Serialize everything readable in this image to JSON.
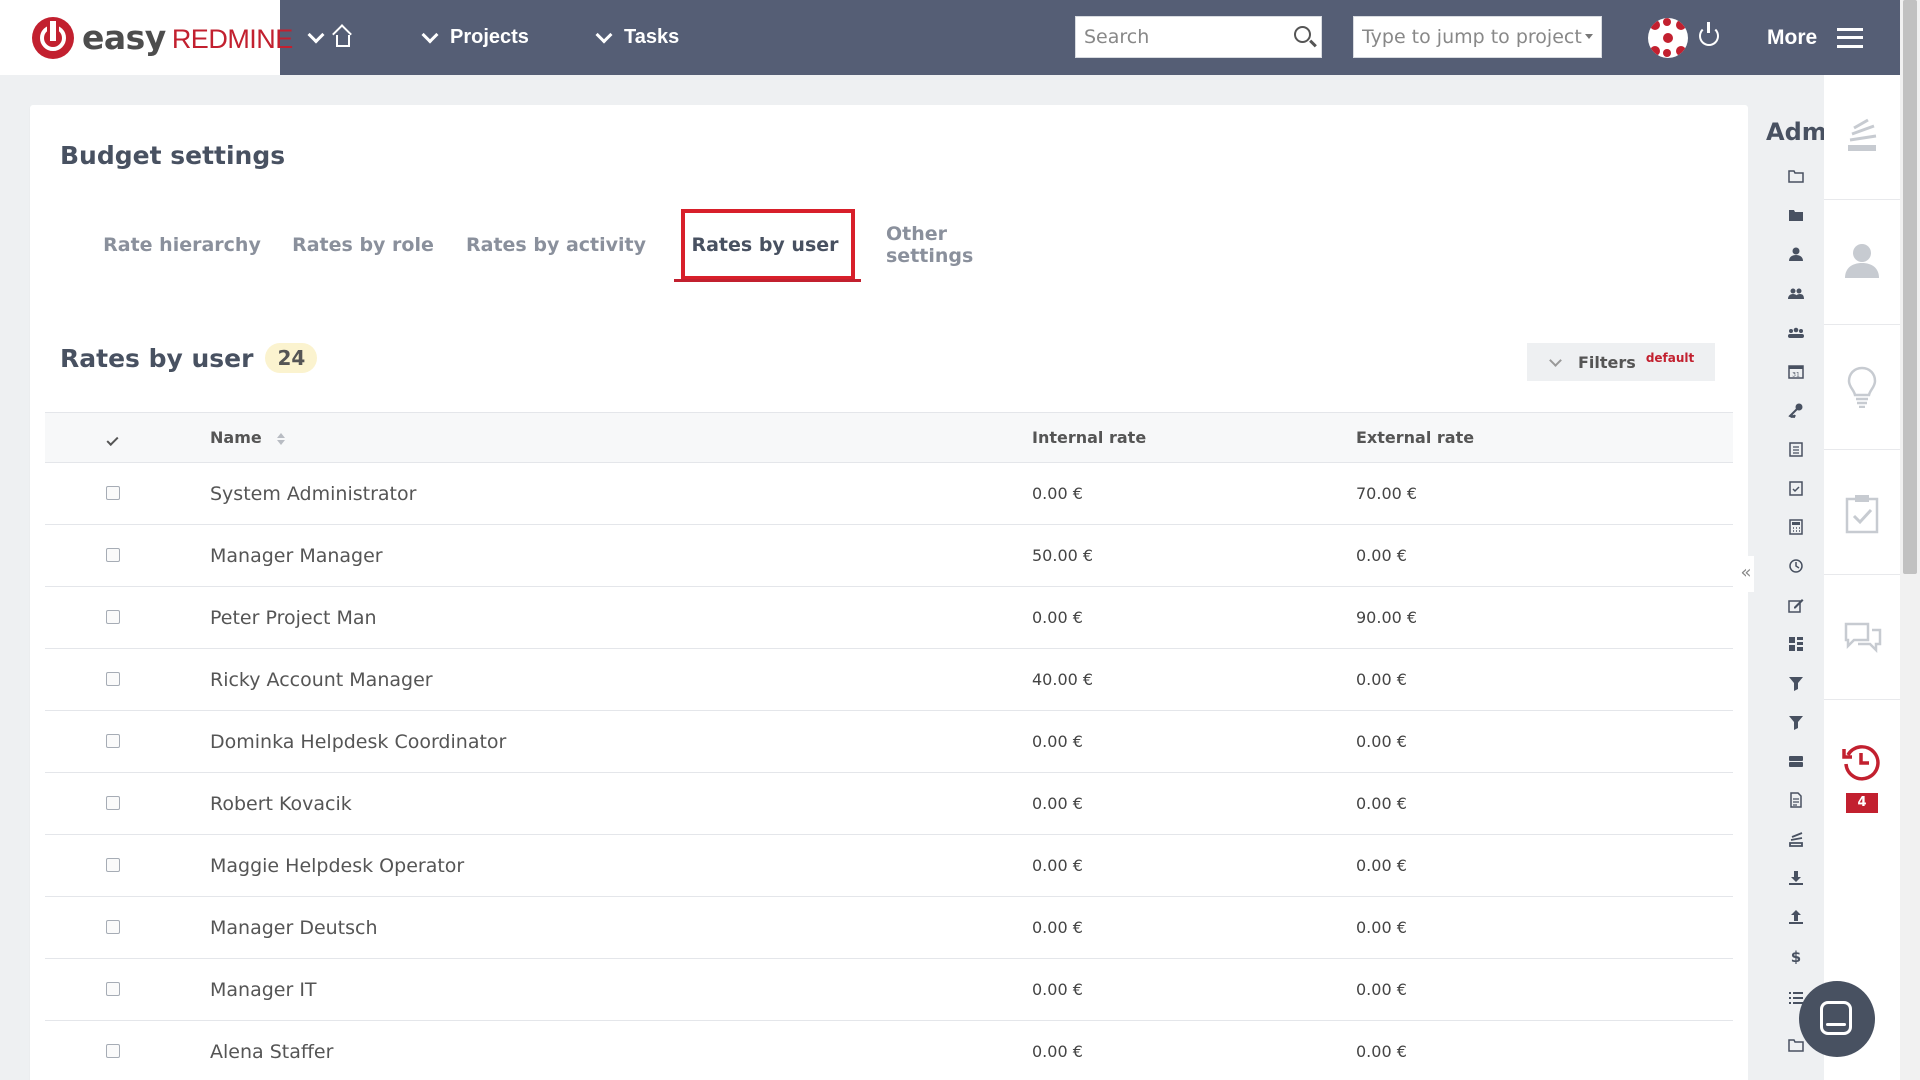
{
  "topbar": {
    "logo_easy": "easy",
    "logo_redmine": "REDMINE",
    "nav_projects": "Projects",
    "nav_tasks": "Tasks",
    "search_placeholder": "Search",
    "jump_placeholder": "Type to jump to project",
    "more_label": "More"
  },
  "page": {
    "title": "Budget settings"
  },
  "tabs": [
    {
      "label": "Rate hierarchy",
      "active": false
    },
    {
      "label": "Rates by role",
      "active": false
    },
    {
      "label": "Rates by activity",
      "active": false
    },
    {
      "label": "Rates by user",
      "active": true
    },
    {
      "label": "Other settings",
      "active": false
    }
  ],
  "list": {
    "title": "Rates by user",
    "count": "24",
    "filters_label": "Filters",
    "filters_badge": "default",
    "columns": {
      "name": "Name",
      "internal": "Internal rate",
      "external": "External rate"
    },
    "rows": [
      {
        "name": "System Administrator",
        "internal": "0.00 €",
        "external": "70.00 €"
      },
      {
        "name": "Manager Manager",
        "internal": "50.00 €",
        "external": "0.00 €"
      },
      {
        "name": "Peter Project Man",
        "internal": "0.00 €",
        "external": "90.00 €"
      },
      {
        "name": "Ricky Account Manager",
        "internal": "40.00 €",
        "external": "0.00 €"
      },
      {
        "name": "Dominka Helpdesk Coordinator",
        "internal": "0.00 €",
        "external": "0.00 €"
      },
      {
        "name": "Robert Kovacik",
        "internal": "0.00 €",
        "external": "0.00 €"
      },
      {
        "name": "Maggie Helpdesk Operator",
        "internal": "0.00 €",
        "external": "0.00 €"
      },
      {
        "name": "Manager Deutsch",
        "internal": "0.00 €",
        "external": "0.00 €"
      },
      {
        "name": "Manager IT",
        "internal": "0.00 €",
        "external": "0.00 €"
      },
      {
        "name": "Alena Staffer",
        "internal": "0.00 €",
        "external": "0.00 €"
      }
    ]
  },
  "admin_sidebar": {
    "title": "Admi",
    "icons": [
      "folder-icon",
      "folder-filled-icon",
      "user-icon",
      "group-icon",
      "users-icon",
      "calendar-icon",
      "key-icon",
      "clipboard-icon",
      "checklist-icon",
      "calculator-icon",
      "history-icon",
      "edit-icon",
      "dashboard-icon",
      "filter-icon",
      "filter-alt-icon",
      "server-icon",
      "document-icon",
      "stack-icon",
      "download-icon",
      "upload-icon",
      "dollar-icon",
      "list-icon",
      "folder-link-icon"
    ]
  },
  "right_rail": {
    "notification_count": "4"
  },
  "colors": {
    "topbar": "#555e75",
    "brand_red": "#c2202f",
    "highlight": "#d81f2a",
    "badge_bg": "#fbf3cf"
  }
}
